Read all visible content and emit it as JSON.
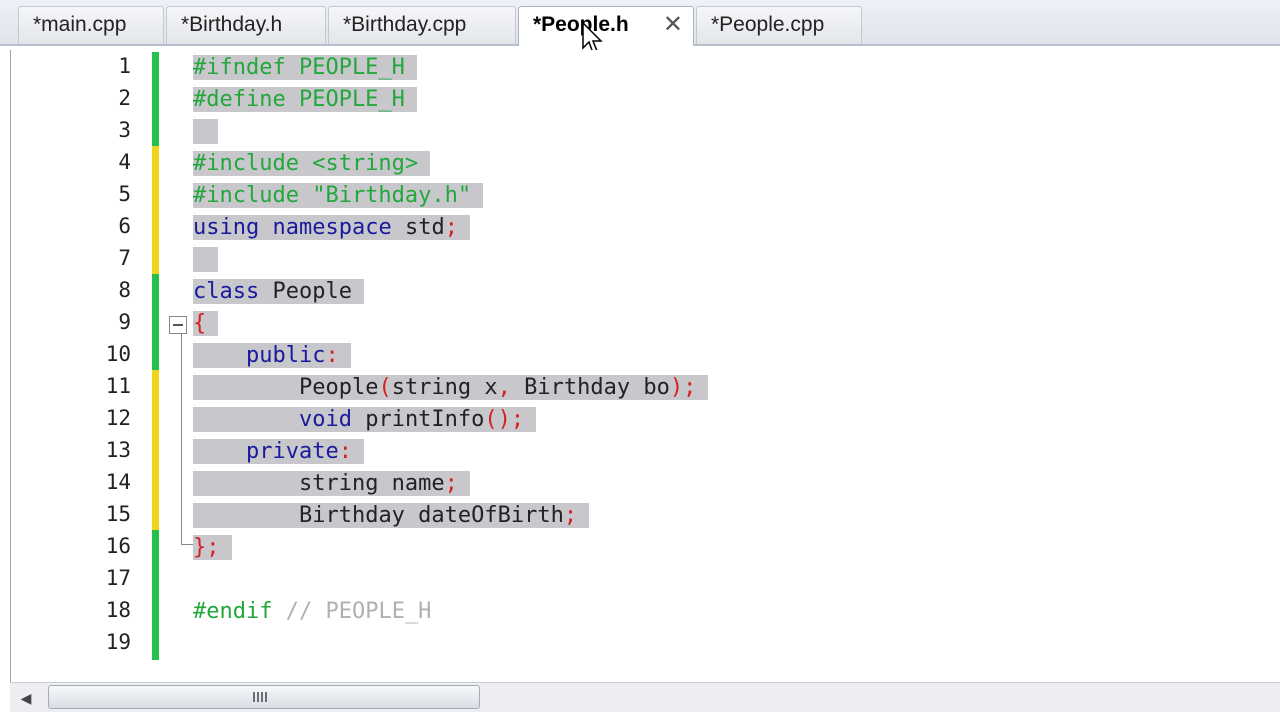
{
  "tabs": [
    {
      "label": "*main.cpp",
      "active": false
    },
    {
      "label": "*Birthday.h",
      "active": false
    },
    {
      "label": "*Birthday.cpp",
      "active": false
    },
    {
      "label": "*People.h",
      "active": true
    },
    {
      "label": "*People.cpp",
      "active": false
    }
  ],
  "tab_close_glyph": "✕",
  "line_numbers": [
    "1",
    "2",
    "3",
    "4",
    "5",
    "6",
    "7",
    "8",
    "9",
    "10",
    "11",
    "12",
    "13",
    "14",
    "15",
    "16",
    "17",
    "18",
    "19"
  ],
  "code": {
    "l1": {
      "a": "#ifndef PEOPLE_H"
    },
    "l2": {
      "a": "#define PEOPLE_H"
    },
    "l4": {
      "a": "#include <string>"
    },
    "l5": {
      "a": "#include \"Birthday.h\""
    },
    "l6": {
      "kw1": "using",
      "kw2": "namespace",
      "id": "std",
      "p": ";"
    },
    "l8": {
      "kw": "class",
      "id": "People"
    },
    "l9": {
      "p": "{"
    },
    "l10": {
      "kw": "public",
      "p": ":"
    },
    "l11": {
      "id1": "People",
      "p1": "(",
      "id2": "string x",
      "p2": ",",
      "id3": "Birthday bo",
      "p3": ");"
    },
    "l12": {
      "kw": "void",
      "id": "printInfo",
      "p": "();"
    },
    "l13": {
      "kw": "private",
      "p": ":"
    },
    "l14": {
      "id": "string name",
      "p": ";"
    },
    "l15": {
      "id": "Birthday dateOfBirth",
      "p": ";"
    },
    "l16": {
      "p": "};"
    },
    "l18": {
      "pp": "#endif",
      "cm": "// PEOPLE_H"
    }
  },
  "colors": {
    "preprocessor": "#22a83a",
    "keyword": "#1a1a9c",
    "punctuation": "#d32020",
    "comment": "#b0b0b0",
    "selection": "#c8c8cc",
    "saved_bar": "#22c24a",
    "modified_bar": "#f2d21c"
  },
  "scrollbar": {
    "left_arrow": "◀"
  }
}
